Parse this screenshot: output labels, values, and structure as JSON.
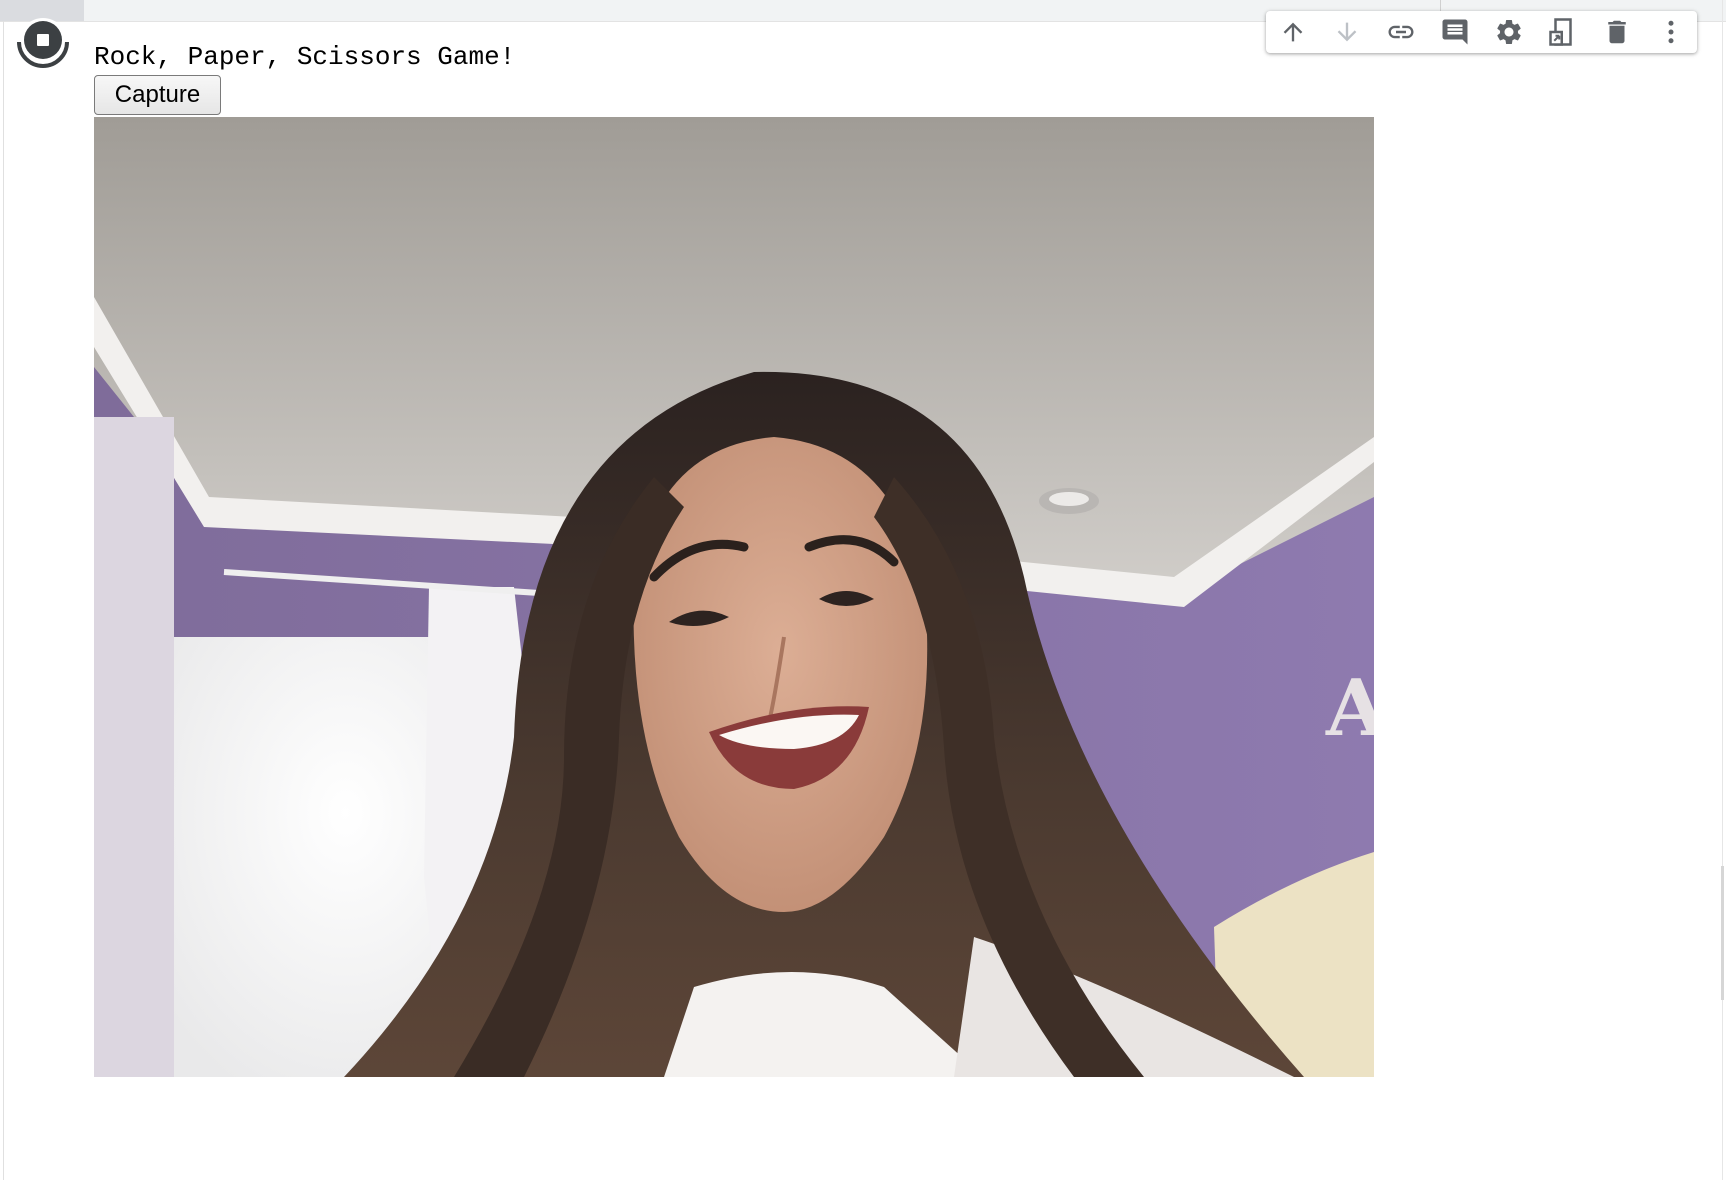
{
  "output": {
    "title": "Rock, Paper, Scissors Game!",
    "capture_label": "Capture"
  },
  "toolbar": {
    "items": [
      {
        "name": "move-up-icon",
        "enabled": true
      },
      {
        "name": "move-down-icon",
        "enabled": false
      },
      {
        "name": "link-icon",
        "enabled": true
      },
      {
        "name": "comment-icon",
        "enabled": true
      },
      {
        "name": "gear-icon",
        "enabled": true
      },
      {
        "name": "mirror-cell-icon",
        "enabled": true
      },
      {
        "name": "delete-icon",
        "enabled": true
      },
      {
        "name": "more-vert-icon",
        "enabled": true
      }
    ]
  },
  "colors": {
    "icon": "#5f6368",
    "icon_disabled": "#bdc1c6",
    "wall": "#8a76a6",
    "ceiling": "#d8d4d0"
  }
}
